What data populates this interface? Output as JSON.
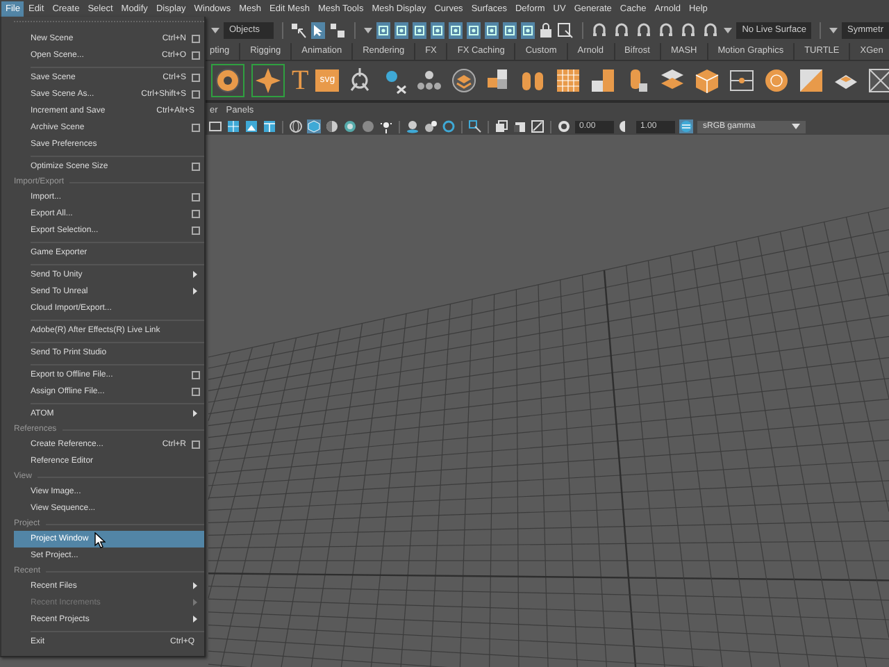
{
  "menubar": [
    {
      "label": "File",
      "selected": true
    },
    {
      "label": "Edit",
      "selected": false
    },
    {
      "label": "Create",
      "selected": false
    },
    {
      "label": "Select",
      "selected": false
    },
    {
      "label": "Modify",
      "selected": false
    },
    {
      "label": "Display",
      "selected": false
    },
    {
      "label": "Windows",
      "selected": false
    },
    {
      "label": "Mesh",
      "selected": false
    },
    {
      "label": "Edit Mesh",
      "selected": false
    },
    {
      "label": "Mesh Tools",
      "selected": false
    },
    {
      "label": "Mesh Display",
      "selected": false
    },
    {
      "label": "Curves",
      "selected": false
    },
    {
      "label": "Surfaces",
      "selected": false
    },
    {
      "label": "Deform",
      "selected": false
    },
    {
      "label": "UV",
      "selected": false
    },
    {
      "label": "Generate",
      "selected": false
    },
    {
      "label": "Cache",
      "selected": false
    },
    {
      "label": "Arnold",
      "selected": false
    },
    {
      "label": "Help",
      "selected": false
    }
  ],
  "status_line": {
    "selection_mode": "Objects",
    "live_surface": "No Live Surface",
    "symmetry": "Symmetr"
  },
  "shelf": {
    "tabs": [
      {
        "label": "pting",
        "selected": false
      },
      {
        "label": "Rigging",
        "selected": false
      },
      {
        "label": "Animation",
        "selected": false
      },
      {
        "label": "Rendering",
        "selected": false
      },
      {
        "label": "FX",
        "selected": false
      },
      {
        "label": "FX Caching",
        "selected": false
      },
      {
        "label": "Custom",
        "selected": false
      },
      {
        "label": "Arnold",
        "selected": false
      },
      {
        "label": "Bifrost",
        "selected": false
      },
      {
        "label": "MASH",
        "selected": false
      },
      {
        "label": "Motion Graphics",
        "selected": false
      },
      {
        "label": "TURTLE",
        "selected": false
      },
      {
        "label": "XGen",
        "selected": false
      }
    ],
    "text_tools": [
      "T",
      "svg"
    ]
  },
  "viewport": {
    "menus": [
      "er",
      "Panels"
    ],
    "exposure": "0.00",
    "gamma": "1.00",
    "color_space": "sRGB gamma"
  },
  "file_menu": {
    "items": [
      {
        "kind": "item",
        "label": "New Scene",
        "shortcut": "Ctrl+N",
        "option_box": true,
        "submenu": false,
        "disabled": false,
        "selected": false
      },
      {
        "kind": "item",
        "label": "Open Scene...",
        "shortcut": "Ctrl+O",
        "option_box": true,
        "submenu": false,
        "disabled": false,
        "selected": false
      },
      {
        "kind": "separator"
      },
      {
        "kind": "item",
        "label": "Save Scene",
        "shortcut": "Ctrl+S",
        "option_box": true,
        "submenu": false,
        "disabled": false,
        "selected": false
      },
      {
        "kind": "item",
        "label": "Save Scene As...",
        "shortcut": "Ctrl+Shift+S",
        "option_box": true,
        "submenu": false,
        "disabled": false,
        "selected": false
      },
      {
        "kind": "item",
        "label": "Increment and Save",
        "shortcut": "Ctrl+Alt+S",
        "option_box": false,
        "submenu": false,
        "disabled": false,
        "selected": false
      },
      {
        "kind": "item",
        "label": "Archive Scene",
        "option_box": true,
        "submenu": false,
        "disabled": false,
        "selected": false
      },
      {
        "kind": "item",
        "label": "Save Preferences",
        "option_box": false,
        "submenu": false,
        "disabled": false,
        "selected": false
      },
      {
        "kind": "separator"
      },
      {
        "kind": "item",
        "label": "Optimize Scene Size",
        "option_box": true,
        "submenu": false,
        "disabled": false,
        "selected": false
      },
      {
        "kind": "section",
        "label": "Import/Export"
      },
      {
        "kind": "item",
        "label": "Import...",
        "option_box": true,
        "submenu": false,
        "disabled": false,
        "selected": false
      },
      {
        "kind": "item",
        "label": "Export All...",
        "option_box": true,
        "submenu": false,
        "disabled": false,
        "selected": false
      },
      {
        "kind": "item",
        "label": "Export Selection...",
        "option_box": true,
        "submenu": false,
        "disabled": false,
        "selected": false
      },
      {
        "kind": "separator"
      },
      {
        "kind": "item",
        "label": "Game Exporter",
        "option_box": false,
        "submenu": false,
        "disabled": false,
        "selected": false
      },
      {
        "kind": "separator"
      },
      {
        "kind": "item",
        "label": "Send To Unity",
        "option_box": false,
        "submenu": true,
        "disabled": false,
        "selected": false
      },
      {
        "kind": "item",
        "label": "Send To Unreal",
        "option_box": false,
        "submenu": true,
        "disabled": false,
        "selected": false
      },
      {
        "kind": "item",
        "label": "Cloud Import/Export...",
        "option_box": false,
        "submenu": false,
        "disabled": false,
        "selected": false
      },
      {
        "kind": "separator"
      },
      {
        "kind": "item",
        "label": "Adobe(R) After Effects(R) Live Link",
        "option_box": false,
        "submenu": false,
        "disabled": false,
        "selected": false
      },
      {
        "kind": "separator"
      },
      {
        "kind": "item",
        "label": "Send To Print Studio",
        "option_box": false,
        "submenu": false,
        "disabled": false,
        "selected": false
      },
      {
        "kind": "separator"
      },
      {
        "kind": "item",
        "label": "Export to Offline File...",
        "option_box": true,
        "submenu": false,
        "disabled": false,
        "selected": false
      },
      {
        "kind": "item",
        "label": "Assign Offline File...",
        "option_box": true,
        "submenu": false,
        "disabled": false,
        "selected": false
      },
      {
        "kind": "separator"
      },
      {
        "kind": "item",
        "label": "ATOM",
        "option_box": false,
        "submenu": true,
        "disabled": false,
        "selected": false
      },
      {
        "kind": "section",
        "label": "References"
      },
      {
        "kind": "item",
        "label": "Create Reference...",
        "shortcut": "Ctrl+R",
        "option_box": true,
        "submenu": false,
        "disabled": false,
        "selected": false
      },
      {
        "kind": "item",
        "label": "Reference Editor",
        "option_box": false,
        "submenu": false,
        "disabled": false,
        "selected": false
      },
      {
        "kind": "section",
        "label": "View"
      },
      {
        "kind": "item",
        "label": "View Image...",
        "option_box": false,
        "submenu": false,
        "disabled": false,
        "selected": false
      },
      {
        "kind": "item",
        "label": "View Sequence...",
        "option_box": false,
        "submenu": false,
        "disabled": false,
        "selected": false
      },
      {
        "kind": "section",
        "label": "Project"
      },
      {
        "kind": "item",
        "label": "Project Window",
        "option_box": false,
        "submenu": false,
        "disabled": false,
        "selected": true
      },
      {
        "kind": "item",
        "label": "Set Project...",
        "option_box": false,
        "submenu": false,
        "disabled": false,
        "selected": false
      },
      {
        "kind": "section",
        "label": "Recent"
      },
      {
        "kind": "item",
        "label": "Recent Files",
        "option_box": false,
        "submenu": true,
        "disabled": false,
        "selected": false
      },
      {
        "kind": "item",
        "label": "Recent Increments",
        "option_box": false,
        "submenu": true,
        "disabled": true,
        "selected": false
      },
      {
        "kind": "item",
        "label": "Recent Projects",
        "option_box": false,
        "submenu": true,
        "disabled": false,
        "selected": false
      },
      {
        "kind": "separator"
      },
      {
        "kind": "item",
        "label": "Exit",
        "shortcut": "Ctrl+Q",
        "option_box": false,
        "submenu": false,
        "disabled": false,
        "selected": false
      }
    ]
  }
}
